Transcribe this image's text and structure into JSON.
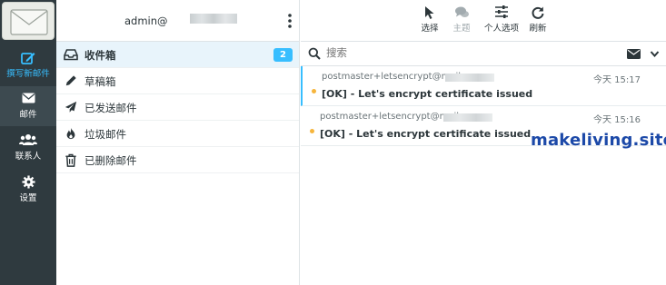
{
  "nav": {
    "items": [
      {
        "label": "撰写新邮件",
        "icon": "compose-icon"
      },
      {
        "label": "邮件",
        "icon": "mail-icon"
      },
      {
        "label": "联系人",
        "icon": "contacts-icon"
      },
      {
        "label": "设置",
        "icon": "gear-icon"
      }
    ]
  },
  "account": {
    "name": "admin@"
  },
  "folders": [
    {
      "label": "收件箱",
      "icon": "inbox-icon",
      "badge": "2"
    },
    {
      "label": "草稿箱",
      "icon": "pencil-icon"
    },
    {
      "label": "已发送邮件",
      "icon": "paper-plane-icon"
    },
    {
      "label": "垃圾邮件",
      "icon": "fire-icon"
    },
    {
      "label": "已删除邮件",
      "icon": "trash-icon"
    }
  ],
  "toolbar": {
    "select_label": "选择",
    "thread_label": "主题",
    "options_label": "个人选项",
    "refresh_label": "刷新"
  },
  "search": {
    "placeholder": "搜索"
  },
  "messages": [
    {
      "from": "postmaster+letsencrypt@mail.",
      "date": "今天 15:17",
      "subject": "[OK] - Let's encrypt certificate issued"
    },
    {
      "from": "postmaster+letsencrypt@mail.",
      "date": "今天 15:16",
      "subject": "[OK] - Let's encrypt certificate issued"
    }
  ],
  "watermark": "makeliving.site",
  "colors": {
    "accent": "#37beff",
    "nav_bg": "#2f3a3f",
    "unread_dot": "#f6b53c"
  }
}
